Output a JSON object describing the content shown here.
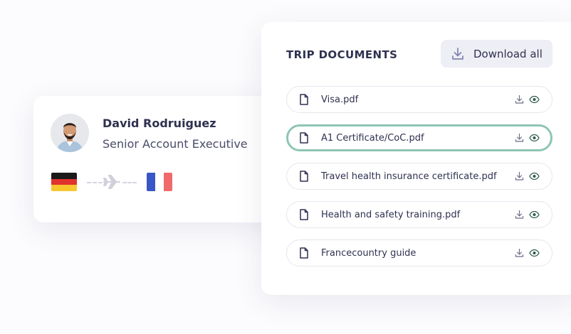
{
  "profile": {
    "name": "David Rodruiguez",
    "role": "Senior Account Executive",
    "avatar_icon": "person-avatar",
    "origin_flag": "germany-flag",
    "destination_flag": "france-flag",
    "route_icon": "airplane-icon"
  },
  "documents": {
    "title": "TRIP DOCUMENTS",
    "download_all_label": "Download all",
    "download_all_icon": "download-icon",
    "selected_index": 1,
    "accent_color": "#8ec5b5",
    "items": [
      {
        "name": "Visa.pdf"
      },
      {
        "name": "A1 Certificate/CoC.pdf"
      },
      {
        "name": "Travel health insurance certificate.pdf"
      },
      {
        "name": "Health and safety training.pdf"
      },
      {
        "name": "Francecountry guide"
      }
    ]
  }
}
